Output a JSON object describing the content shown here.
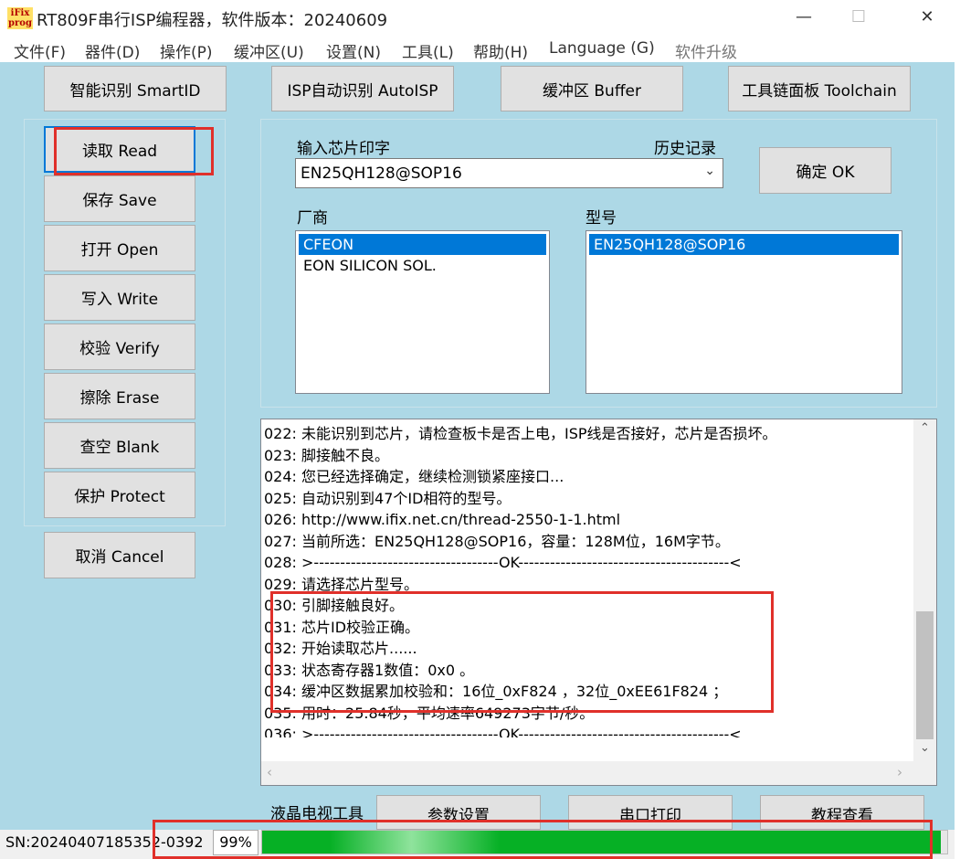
{
  "window": {
    "logo_text": "iFix prog",
    "title": "RT809F串行ISP编程器，软件版本：20240609"
  },
  "menu": [
    "文件(F)",
    "器件(D)",
    "操作(P)",
    "缓冲区(U)",
    "设置(N)",
    "工具(L)",
    "帮助(H)",
    "Language (G)",
    "软件升级"
  ],
  "top_buttons": {
    "smartid": "智能识别 SmartID",
    "autoisp": "ISP自动识别 AutoISP",
    "buffer": "缓冲区 Buffer",
    "toolchain": "工具链面板 Toolchain"
  },
  "ops": {
    "read": "读取 Read",
    "save": "保存 Save",
    "open": "打开 Open",
    "write": "写入 Write",
    "verify": "校验 Verify",
    "erase": "擦除 Erase",
    "blank": "查空 Blank",
    "protect": "保护 Protect",
    "cancel": "取消 Cancel"
  },
  "chip": {
    "input_label": "输入芯片印字",
    "history_label": "历史记录",
    "input_value": "EN25QH128@SOP16",
    "ok_label": "确定 OK",
    "vendor_label": "厂商",
    "vendors": [
      "CFEON",
      "EON SILICON SOL."
    ],
    "model_label": "型号",
    "models": [
      "EN25QH128@SOP16"
    ]
  },
  "log": [
    "022: 未能识别到芯片，请检查板卡是否上电，ISP线是否接好，芯片是否损坏。",
    "023: 脚接触不良。",
    "024: 您已经选择确定，继续检测锁紧座接口...",
    "025: 自动识别到47个ID相符的型号。",
    "026: http://www.ifix.net.cn/thread-2550-1-1.html",
    "027: 当前所选：EN25QH128@SOP16，容量：128M位，16M字节。",
    "028: >-----------------------------------OK----------------------------------------<",
    "029: 请选择芯片型号。",
    "030: 引脚接触良好。",
    "031: 芯片ID校验正确。",
    "032: 开始读取芯片......",
    "033: 状态寄存器1数值：0x0 。",
    "034: 缓冲区数据累加校验和：16位_0xF824 ，32位_0xEE61F824 ；",
    "035: 用时：25.84秒，平均速率649273字节/秒。",
    "036: >-----------------------------------OK----------------------------------------<"
  ],
  "bottom": {
    "lcd_tool": "液晶电视工具",
    "params": "参数设置",
    "serial_print": "串口打印",
    "tutorial": "教程查看"
  },
  "status": {
    "sn": "SN:20240407185352-0392",
    "progress_text": "99%",
    "progress_value": 0.99
  },
  "colors": {
    "client_bg": "#add8e6",
    "highlight_box": "#e0302a",
    "progress_green": "#06b025",
    "selection": "#0078d7"
  }
}
